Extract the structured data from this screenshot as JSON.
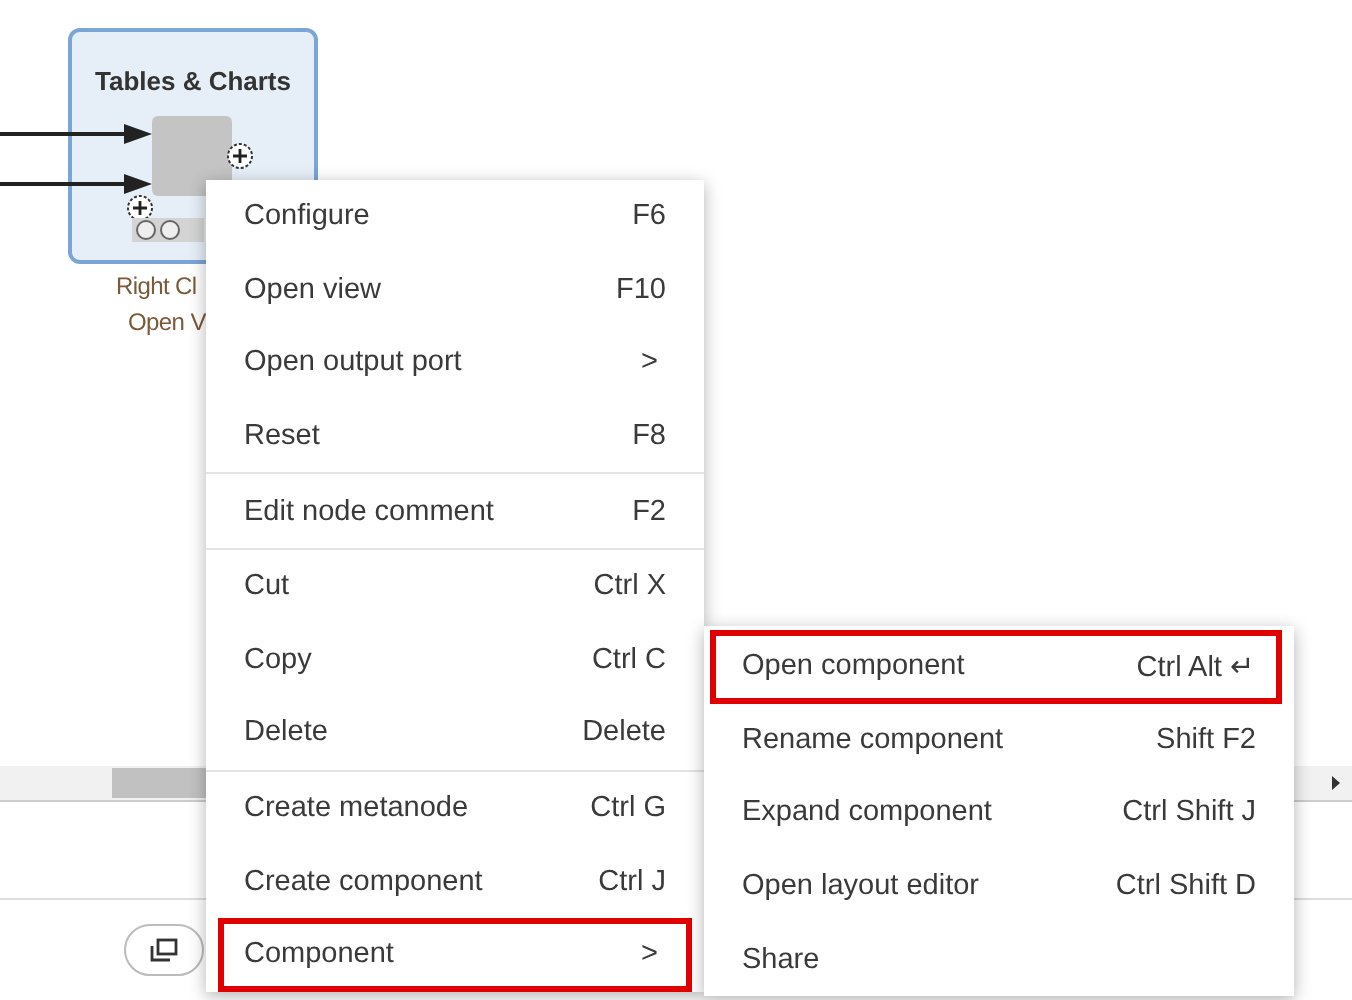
{
  "node": {
    "title": "Tables & Charts",
    "label_lines": [
      "Right Cl",
      "Open V"
    ]
  },
  "context_menu": {
    "groups": [
      [
        {
          "label": "Configure",
          "shortcut": "F6",
          "kind": "plain",
          "highlighted": false
        },
        {
          "label": "Open view",
          "shortcut": "F10",
          "kind": "plain",
          "highlighted": false
        },
        {
          "label": "Open output port",
          "shortcut": ">",
          "kind": "submenu",
          "highlighted": false
        },
        {
          "label": "Reset",
          "shortcut": "F8",
          "kind": "plain",
          "highlighted": false
        }
      ],
      [
        {
          "label": "Edit node comment",
          "shortcut": "F2",
          "kind": "plain",
          "highlighted": false
        }
      ],
      [
        {
          "label": "Cut",
          "shortcut": "Ctrl X",
          "kind": "plain",
          "highlighted": false
        },
        {
          "label": "Copy",
          "shortcut": "Ctrl C",
          "kind": "plain",
          "highlighted": false
        },
        {
          "label": "Delete",
          "shortcut": "Delete",
          "kind": "plain",
          "highlighted": false
        }
      ],
      [
        {
          "label": "Create metanode",
          "shortcut": "Ctrl G",
          "kind": "plain",
          "highlighted": false
        },
        {
          "label": "Create component",
          "shortcut": "Ctrl J",
          "kind": "plain",
          "highlighted": false
        },
        {
          "label": "Component",
          "shortcut": ">",
          "kind": "submenu",
          "highlighted": true
        }
      ]
    ]
  },
  "submenu": [
    {
      "label": "Open component",
      "shortcut": "Ctrl Alt ↵",
      "highlighted": true
    },
    {
      "label": "Rename component",
      "shortcut": "Shift F2",
      "highlighted": false
    },
    {
      "label": "Expand component",
      "shortcut": "Ctrl Shift J",
      "highlighted": false
    },
    {
      "label": "Open layout editor",
      "shortcut": "Ctrl Shift D",
      "highlighted": false
    },
    {
      "label": "Share",
      "highlighted": false
    }
  ]
}
